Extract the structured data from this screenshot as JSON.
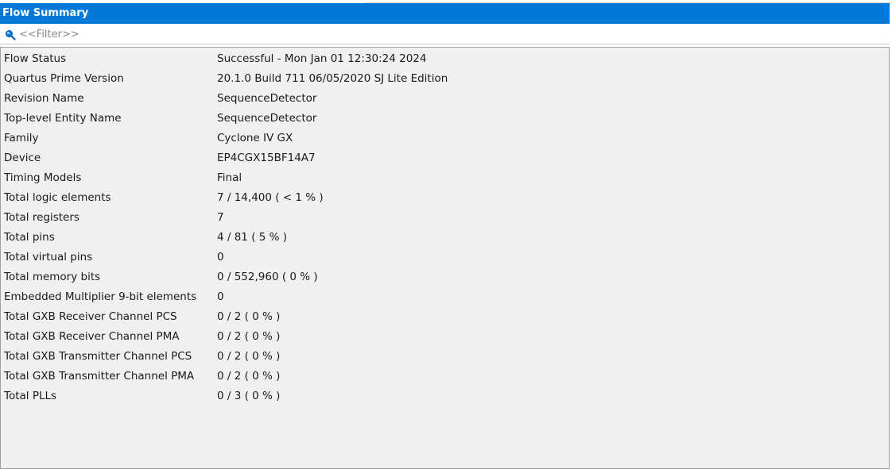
{
  "panel": {
    "title": "Flow Summary"
  },
  "filter": {
    "placeholder": "<<Filter>>",
    "icon": "search-icon"
  },
  "colors": {
    "title_bar": "#0078d7",
    "table_bg": "#f0f0f0"
  },
  "rows": [
    {
      "label": "Flow Status",
      "value": "Successful - Mon Jan 01 12:30:24 2024"
    },
    {
      "label": "Quartus Prime Version",
      "value": "20.1.0 Build 711 06/05/2020 SJ Lite Edition"
    },
    {
      "label": "Revision Name",
      "value": "SequenceDetector"
    },
    {
      "label": "Top-level Entity Name",
      "value": "SequenceDetector"
    },
    {
      "label": "Family",
      "value": "Cyclone IV GX"
    },
    {
      "label": "Device",
      "value": "EP4CGX15BF14A7"
    },
    {
      "label": "Timing Models",
      "value": "Final"
    },
    {
      "label": "Total logic elements",
      "value": "7 / 14,400 ( < 1 % )"
    },
    {
      "label": "Total registers",
      "value": "7"
    },
    {
      "label": "Total pins",
      "value": "4 / 81 ( 5 % )"
    },
    {
      "label": "Total virtual pins",
      "value": "0"
    },
    {
      "label": "Total memory bits",
      "value": "0 / 552,960 ( 0 % )"
    },
    {
      "label": "Embedded Multiplier 9-bit elements",
      "value": "0"
    },
    {
      "label": "Total GXB Receiver Channel PCS",
      "value": "0 / 2 ( 0 % )"
    },
    {
      "label": "Total GXB Receiver Channel PMA",
      "value": "0 / 2 ( 0 % )"
    },
    {
      "label": "Total GXB Transmitter Channel PCS",
      "value": "0 / 2 ( 0 % )"
    },
    {
      "label": "Total GXB Transmitter Channel PMA",
      "value": "0 / 2 ( 0 % )"
    },
    {
      "label": "Total PLLs",
      "value": "0 / 3 ( 0 % )"
    }
  ]
}
